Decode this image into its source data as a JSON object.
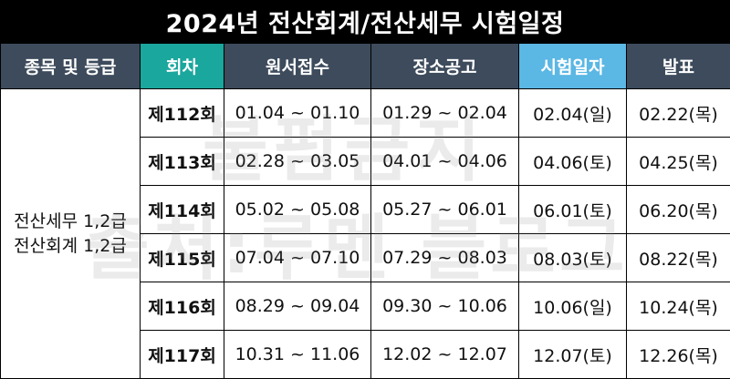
{
  "title": "2024년 전산회계/전산세무 시험일정",
  "headers": {
    "grade": "종목 및 등급",
    "round": "회차",
    "application": "원서접수",
    "venue_notice": "장소공고",
    "exam_date": "시험일자",
    "announcement": "발표"
  },
  "grade_lines": [
    "전산세무 1,2급",
    "전산회계 1,2급"
  ],
  "rows": [
    {
      "round": "제112회",
      "application": "01.04 ~ 01.10",
      "venue_notice": "01.29 ~ 02.04",
      "exam_date": "02.04(일)",
      "announcement": "02.22(목)"
    },
    {
      "round": "제113회",
      "application": "02.28 ~ 03.05",
      "venue_notice": "04.01 ~ 04.06",
      "exam_date": "04.06(토)",
      "announcement": "04.25(목)"
    },
    {
      "round": "제114회",
      "application": "05.02 ~ 05.08",
      "venue_notice": "05.27 ~ 06.01",
      "exam_date": "06.01(토)",
      "announcement": "06.20(목)"
    },
    {
      "round": "제115회",
      "application": "07.04 ~ 07.10",
      "venue_notice": "07.29 ~ 08.03",
      "exam_date": "08.03(토)",
      "announcement": "08.22(목)"
    },
    {
      "round": "제116회",
      "application": "08.29 ~ 09.04",
      "venue_notice": "09.30 ~ 10.06",
      "exam_date": "10.06(일)",
      "announcement": "10.24(목)"
    },
    {
      "round": "제117회",
      "application": "10.31 ~ 11.06",
      "venue_notice": "12.02 ~ 12.07",
      "exam_date": "12.07(토)",
      "announcement": "12.26(목)"
    }
  ],
  "watermark": {
    "line1": "불펌금지",
    "line2": "출처:루멘 블로그"
  },
  "colors": {
    "header_default": "#3d4b5c",
    "header_round": "#1aa79d",
    "header_exam_date": "#5bb7e4",
    "round_text": "#1aa79d",
    "exam_sunday": "#e8242b",
    "exam_saturday": "#3aa7d9"
  }
}
